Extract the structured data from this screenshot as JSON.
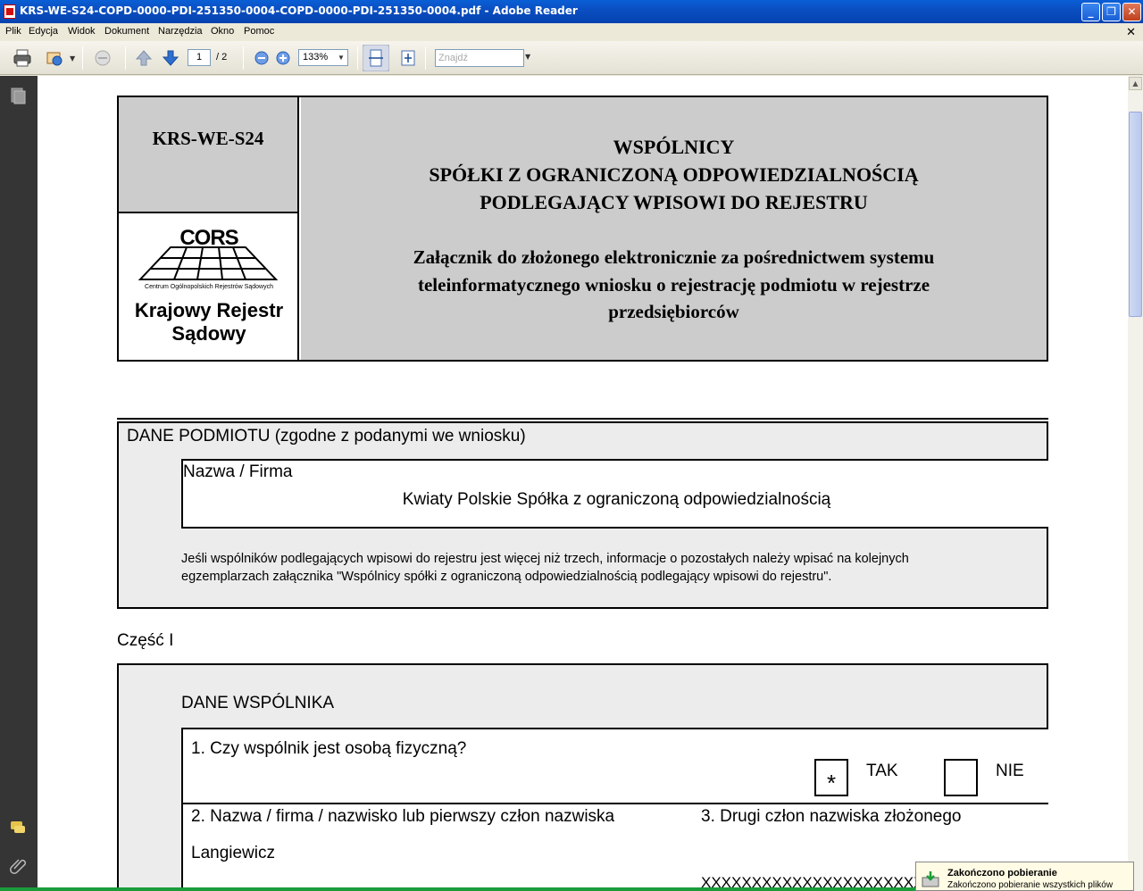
{
  "window": {
    "title": "KRS-WE-S24-COPD-0000-PDI-251350-0004-COPD-0000-PDI-251350-0004.pdf - Adobe Reader",
    "min_label": "_",
    "max_label": "❐",
    "close_label": "✕"
  },
  "menu": {
    "items": [
      "Plik",
      "Edycja",
      "Widok",
      "Dokument",
      "Narzędzia",
      "Okno",
      "Pomoc"
    ],
    "close_doc": "✕"
  },
  "toolbar": {
    "page_current": "1",
    "page_total": "/ 2",
    "zoom": "133%",
    "find_placeholder": "Znajdź"
  },
  "document": {
    "form_code": "KRS-WE-S24",
    "logo_cors": "CORS",
    "logo_small": "Centrum Ogólnopolskich Rejestrów Sądowych",
    "logo_name_line1": "Krajowy Rejestr",
    "logo_name_line2": "Sądowy",
    "heading_line1": "WSPÓLNICY",
    "heading_line2": "SPÓŁKI Z OGRANICZONĄ ODPOWIEDZIALNOŚCIĄ",
    "heading_line3": "PODLEGAJĄCY WPISOWI DO REJESTRU",
    "sub_line1": "Załącznik do złożonego elektronicznie za pośrednictwem systemu",
    "sub_line2": "teleinformatycznego wniosku o rejestrację podmiotu w rejestrze",
    "sub_line3": "przedsiębiorców",
    "dane_podmiotu_label": "DANE PODMIOTU (zgodne z podanymi we wniosku)",
    "nazwa_firma_label": "Nazwa / Firma",
    "nazwa_firma_value": "Kwiaty Polskie Spółka z ograniczoną odpowiedzialnością",
    "info_line1": "Jeśli wspólników podlegających wpisowi do rejestru jest więcej niż trzech, informacje o pozostałych należy wpisać na kolejnych",
    "info_line2": "egzemplarzach załącznika \"Wspólnicy spółki z ograniczoną odpowiedzialnością podlegający wpisowi do rejestru\".",
    "part_label": "Część I",
    "dane_wspolnika_label": "DANE WSPÓLNIKA",
    "q1_label": "1. Czy wspólnik jest osobą fizyczną?",
    "tak_mark": "*",
    "tak_label": "TAK",
    "nie_label": "NIE",
    "q2_label": "2. Nazwa / firma / nazwisko lub pierwszy człon nazwiska",
    "q2_value": "Langiewicz",
    "q3_label": "3. Drugi człon nazwiska złożonego",
    "q3_value": "XXXXXXXXXXXXXXXXXXXXXXXX"
  },
  "notification": {
    "title": "Zakończono pobieranie",
    "text": "Zakończono pobieranie wszystkich plików"
  }
}
